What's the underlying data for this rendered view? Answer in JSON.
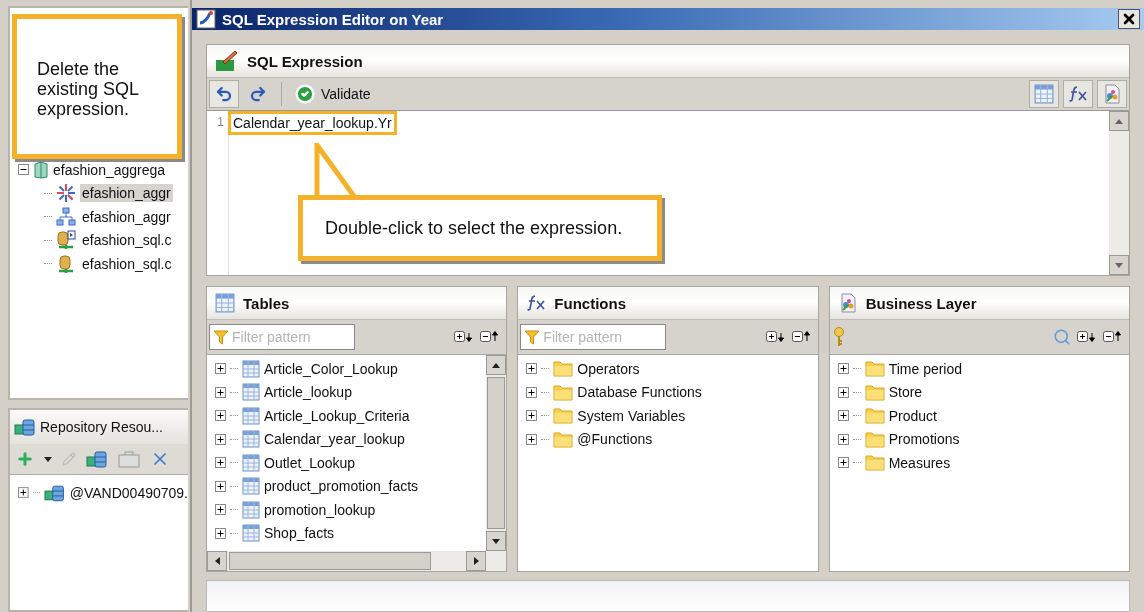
{
  "background_app": {
    "tree": [
      {
        "label": "efashion_aggrega",
        "expanded": true,
        "children": [
          {
            "label": "efashion_aggr",
            "kind": "star",
            "selected": true
          },
          {
            "label": "efashion_aggr",
            "kind": "network",
            "selected": false
          },
          {
            "label": "efashion_sql.c",
            "kind": "db-link",
            "selected": false
          },
          {
            "label": "efashion_sql.c",
            "kind": "db",
            "selected": false
          }
        ]
      }
    ],
    "repository": {
      "title": "Repository Resou...",
      "tree": [
        {
          "label": "@VAND00490709.",
          "expanded": false
        }
      ]
    }
  },
  "dialog": {
    "title": "SQL Expression Editor on Year",
    "sql_panel": {
      "title": "SQL Expression",
      "validate": "Validate",
      "line_numbers": [
        "1"
      ],
      "expression": "Calendar_year_lookup.Yr"
    },
    "panels": [
      {
        "kind": "tables",
        "title": "Tables",
        "filter_placeholder": "Filter pattern",
        "items": [
          {
            "label": "Article_Color_Lookup",
            "expanded": false
          },
          {
            "label": "Article_lookup",
            "expanded": false
          },
          {
            "label": "Article_Lookup_Criteria",
            "expanded": false
          },
          {
            "label": "Calendar_year_lookup",
            "expanded": false
          },
          {
            "label": "Outlet_Lookup",
            "expanded": false
          },
          {
            "label": "product_promotion_facts",
            "expanded": false
          },
          {
            "label": "promotion_lookup",
            "expanded": false
          },
          {
            "label": "Shop_facts",
            "expanded": false
          }
        ]
      },
      {
        "kind": "functions",
        "title": "Functions",
        "filter_placeholder": "Filter pattern",
        "items": [
          {
            "label": "Operators",
            "expanded": false
          },
          {
            "label": "Database Functions",
            "expanded": false
          },
          {
            "label": "System Variables",
            "expanded": false
          },
          {
            "label": "@Functions",
            "expanded": false
          }
        ]
      },
      {
        "kind": "business",
        "title": "Business Layer",
        "items": [
          {
            "label": "Time period",
            "expanded": false
          },
          {
            "label": "Store",
            "expanded": false
          },
          {
            "label": "Product",
            "expanded": false
          },
          {
            "label": "Promotions",
            "expanded": false
          },
          {
            "label": "Measures",
            "expanded": false
          }
        ]
      }
    ]
  },
  "callouts": [
    {
      "text": "Delete the existing SQL expression."
    },
    {
      "text": "Double-click to select the expression."
    }
  ]
}
